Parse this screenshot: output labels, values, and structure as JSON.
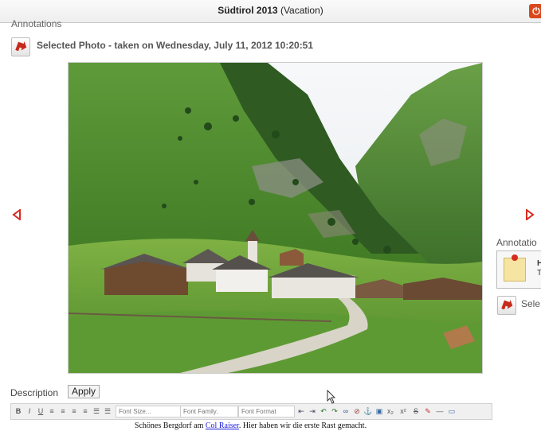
{
  "window": {
    "title_strong": "Südtirol 2013",
    "title_rest": " (Vacation)"
  },
  "annotations_heading": "Annotations",
  "selected_photo_label": "Selected Photo - taken on Wednesday, July 11, 2012 10:20:51",
  "photo": {
    "description": "mountain valley village with chapel"
  },
  "side_panel": {
    "heading": "Annotatio",
    "card_line1": "H",
    "card_line2": "T",
    "select_label": "Sele"
  },
  "description": {
    "label": "Description",
    "apply": "Apply"
  },
  "toolbar": {
    "bold": "B",
    "italic": "I",
    "underline": "U",
    "font_size": "Font Size...",
    "font_family": "Font Family.",
    "font_format": "Font Format",
    "subscript": "x₂",
    "superscript": "x²",
    "strike": "S"
  },
  "editor": {
    "text_before": "Schönes Bergdorf am ",
    "link": "Col Raiser",
    "text_after": ". Hier haben wir die erste Rast gemacht."
  },
  "colors": {
    "accent_red": "#d62b1f",
    "close_orange": "#d9471d"
  }
}
